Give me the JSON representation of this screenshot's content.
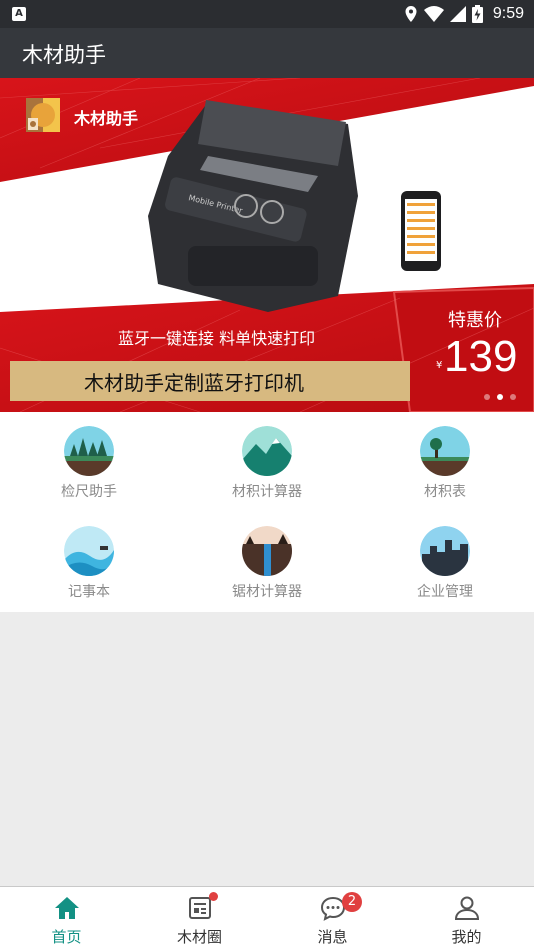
{
  "status_bar": {
    "time": "9:59",
    "icons": [
      "app-notification-icon",
      "location-icon",
      "wifi-icon",
      "cellular-signal-icon",
      "battery-charging-icon"
    ]
  },
  "app_bar": {
    "title": "木材助手"
  },
  "banner": {
    "brand": "木材助手",
    "slogan": "蓝牙一键连接 料单快速打印",
    "headline": "木材助手定制蓝牙打印机",
    "promo_label": "特惠价",
    "currency": "¥",
    "price": "139",
    "printer_text": "Mobile Printer",
    "carousel": {
      "count": 3,
      "active": 1
    },
    "colors": {
      "red": "#cf0f14",
      "gold": "#d7b980"
    }
  },
  "grid": {
    "items": [
      {
        "label": "检尺助手",
        "icon": "forest-scene-icon"
      },
      {
        "label": "材积计算器",
        "icon": "mountain-scene-icon"
      },
      {
        "label": "材积表",
        "icon": "tree-scene-icon"
      },
      {
        "label": "记事本",
        "icon": "wave-scene-icon"
      },
      {
        "label": "锯材计算器",
        "icon": "waterfall-scene-icon"
      },
      {
        "label": "企业管理",
        "icon": "city-scene-icon"
      }
    ]
  },
  "tabbar": {
    "items": [
      {
        "label": "首页",
        "icon": "home-icon",
        "active": true
      },
      {
        "label": "木材圈",
        "icon": "news-feed-icon",
        "active": false,
        "dot": true
      },
      {
        "label": "消息",
        "icon": "message-bubble-icon",
        "active": false,
        "badge": "2"
      },
      {
        "label": "我的",
        "icon": "user-profile-icon",
        "active": false
      }
    ]
  },
  "colors": {
    "accent": "#139184",
    "app_bar": "#35383d",
    "status_bar": "#2b2d31",
    "badge": "#e04040"
  }
}
